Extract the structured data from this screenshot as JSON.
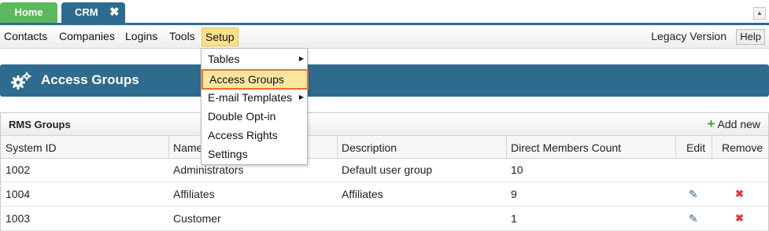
{
  "tabs": {
    "home": "Home",
    "crm": "CRM",
    "close_glyph": "✖"
  },
  "collapse_glyph": "▲",
  "menu": {
    "items": [
      "Contacts",
      "Companies",
      "Logins",
      "Tools",
      "Setup"
    ],
    "legacy": "Legacy Version",
    "help": "Help"
  },
  "page": {
    "title": "Access Groups",
    "icon": "gears-icon"
  },
  "panel": {
    "title": "RMS Groups",
    "add_new": "Add new",
    "columns": [
      "System ID",
      "Name",
      "Description",
      "Direct Members Count",
      "Edit",
      "Remove"
    ],
    "rows": [
      {
        "id": "1002",
        "name": "Administrators",
        "description": "Default user group",
        "count": "10"
      },
      {
        "id": "1004",
        "name": "Affiliates",
        "description": "Affiliates",
        "count": "9"
      },
      {
        "id": "1003",
        "name": "Customer",
        "description": "",
        "count": "1"
      }
    ]
  },
  "dropdown": {
    "items": [
      "Tables",
      "Access Groups",
      "E-mail Templates",
      "Double Opt-in",
      "Access Rights",
      "Settings"
    ],
    "submenu_glyph": "▶"
  },
  "colors": {
    "header_blue": "#2e6b8e",
    "home_green": "#5cb85c",
    "highlight": "#e8722a"
  }
}
